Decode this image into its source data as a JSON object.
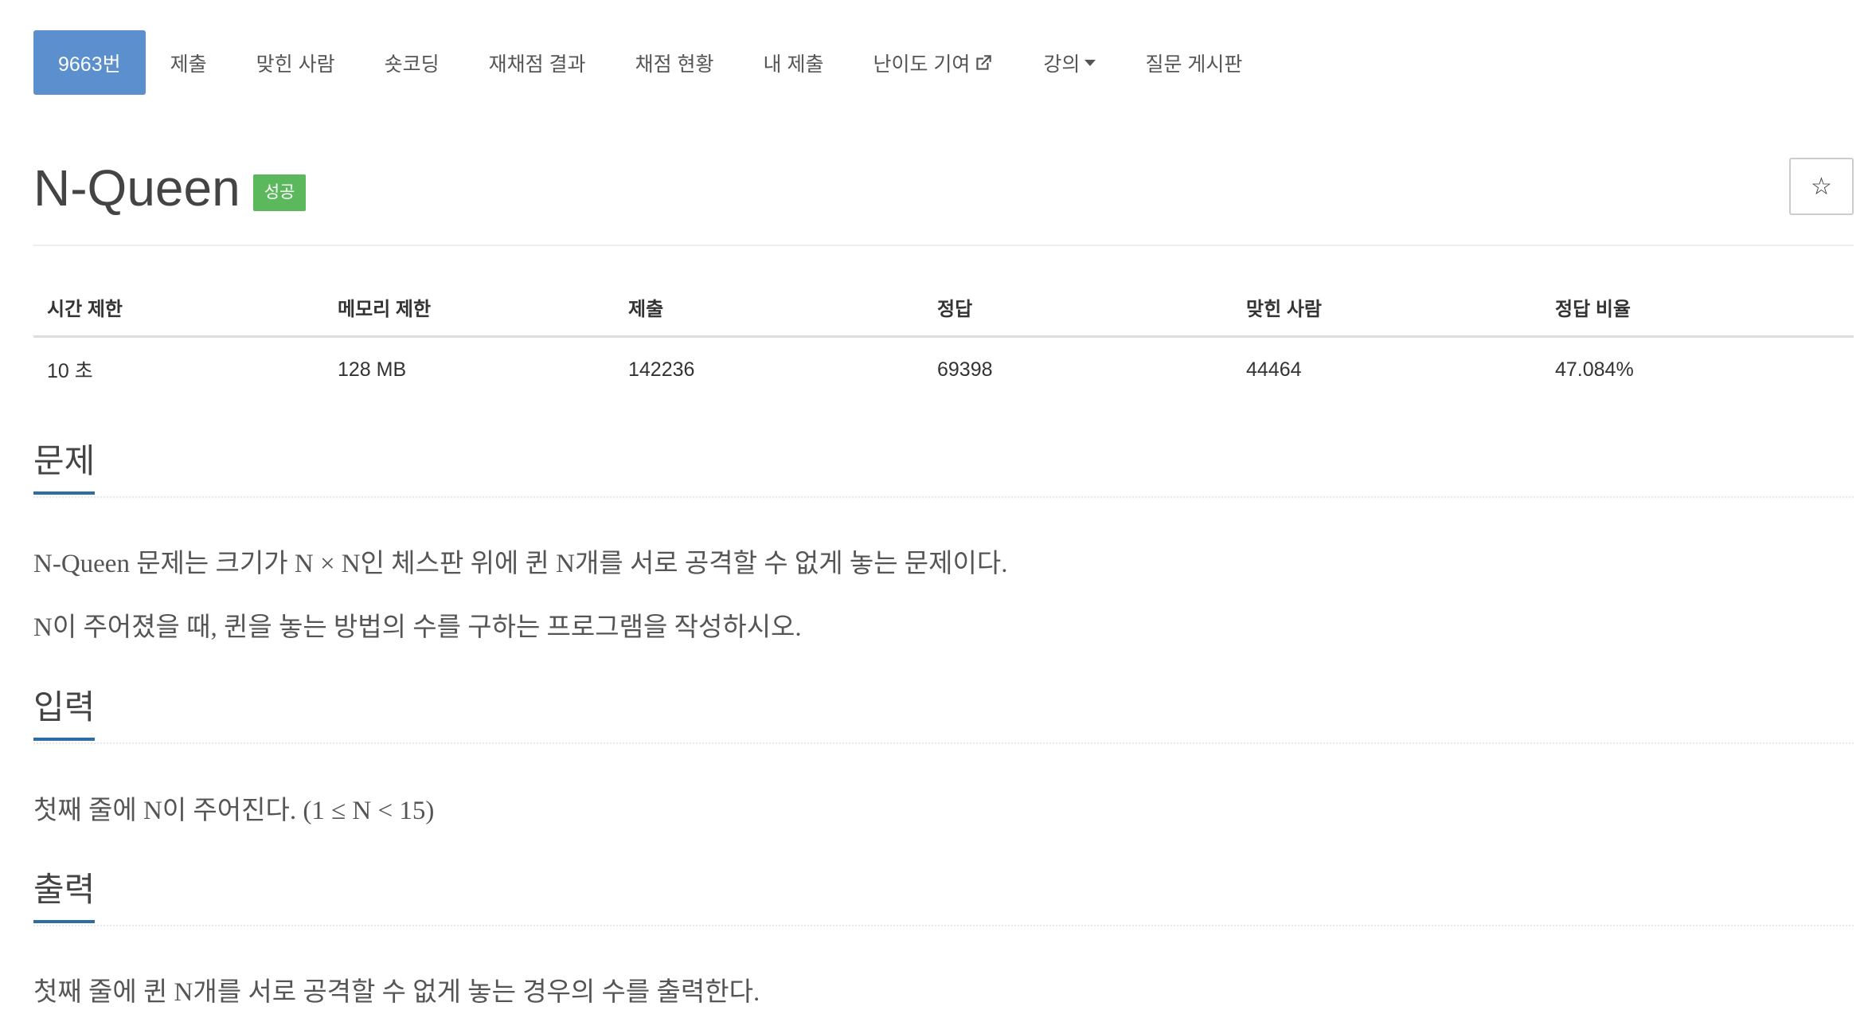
{
  "nav": {
    "items": [
      {
        "label": "9663번"
      },
      {
        "label": "제출"
      },
      {
        "label": "맞힌 사람"
      },
      {
        "label": "숏코딩"
      },
      {
        "label": "재채점 결과"
      },
      {
        "label": "채점 현황"
      },
      {
        "label": "내 제출"
      },
      {
        "label": "난이도 기여",
        "icon": "external-link-icon"
      },
      {
        "label": "강의",
        "icon": "caret-down-icon"
      },
      {
        "label": "질문 게시판"
      }
    ],
    "active_color": "#5b8fcd"
  },
  "problem": {
    "title": "N-Queen",
    "badge": "성공",
    "badge_color": "#5cb85c",
    "star_icon": "☆"
  },
  "stats": {
    "headers": [
      "시간 제한",
      "메모리 제한",
      "제출",
      "정답",
      "맞힌 사람",
      "정답 비율"
    ],
    "values": [
      "10 초",
      "128 MB",
      "142236",
      "69398",
      "44464",
      "47.084%"
    ]
  },
  "sections": {
    "description": {
      "heading": "문제",
      "lines": [
        "N-Queen 문제는 크기가 N × N인 체스판 위에 퀸 N개를 서로 공격할 수 없게 놓는 문제이다.",
        "N이 주어졌을 때, 퀸을 놓는 방법의 수를 구하는 프로그램을 작성하시오."
      ]
    },
    "input": {
      "heading": "입력",
      "lines": [
        "첫째 줄에 N이 주어진다. (1 ≤ N < 15)"
      ]
    },
    "output": {
      "heading": "출력",
      "lines": [
        "첫째 줄에 퀸 N개를 서로 공격할 수 없게 놓는 경우의 수를 출력한다."
      ]
    }
  }
}
